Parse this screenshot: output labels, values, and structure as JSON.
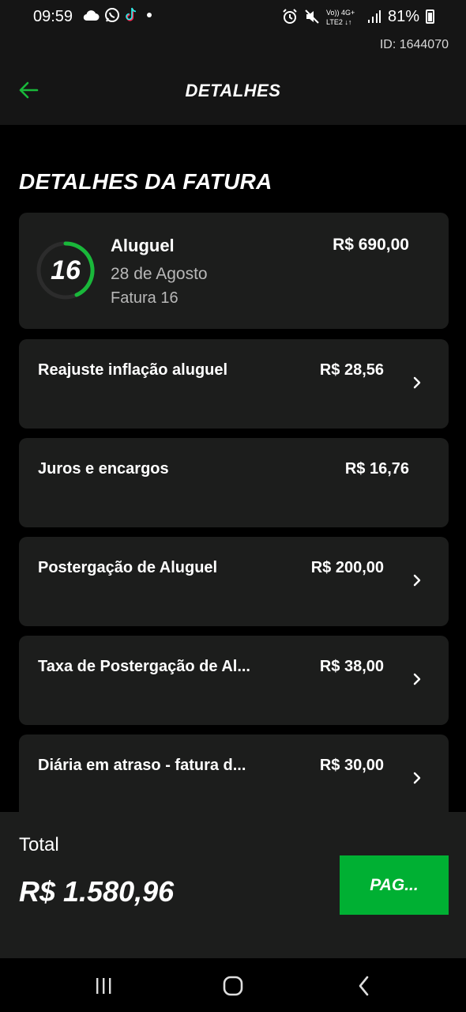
{
  "status_bar": {
    "time": "09:59",
    "battery": "81%",
    "network": "LTE2 4G+",
    "left_icons": [
      "cloud-icon",
      "whatsapp-icon",
      "tiktok-icon",
      "dot-icon"
    ],
    "right_icons": [
      "alarm-icon",
      "mute-icon",
      "volte-icon",
      "signal-icon",
      "battery-icon"
    ]
  },
  "id_label": "ID: 1644070",
  "appbar": {
    "title": "DETALHES"
  },
  "section_title": "DETALHES DA FATURA",
  "main_card": {
    "number": "16",
    "name": "Aluguel",
    "date": "28 de Agosto",
    "subtitle": "Fatura 16",
    "amount": "R$ 690,00"
  },
  "items": [
    {
      "label": "Reajuste inflação aluguel",
      "amount": "R$ 28,56",
      "has_chevron": true
    },
    {
      "label": "Juros e encargos",
      "amount": "R$ 16,76",
      "has_chevron": false
    },
    {
      "label": "Postergação de Aluguel",
      "amount": "R$ 200,00",
      "has_chevron": true
    },
    {
      "label": "Taxa de Postergação de Al...",
      "amount": "R$ 38,00",
      "has_chevron": true
    },
    {
      "label": "Diária em atraso - fatura d...",
      "amount": "R$ 30,00",
      "has_chevron": true
    }
  ],
  "footer": {
    "total_label": "Total",
    "total_value": "R$ 1.580,96",
    "pay_label": "PAG..."
  },
  "colors": {
    "accent": "#00b033",
    "card": "#1c1d1c",
    "background": "#000000"
  }
}
